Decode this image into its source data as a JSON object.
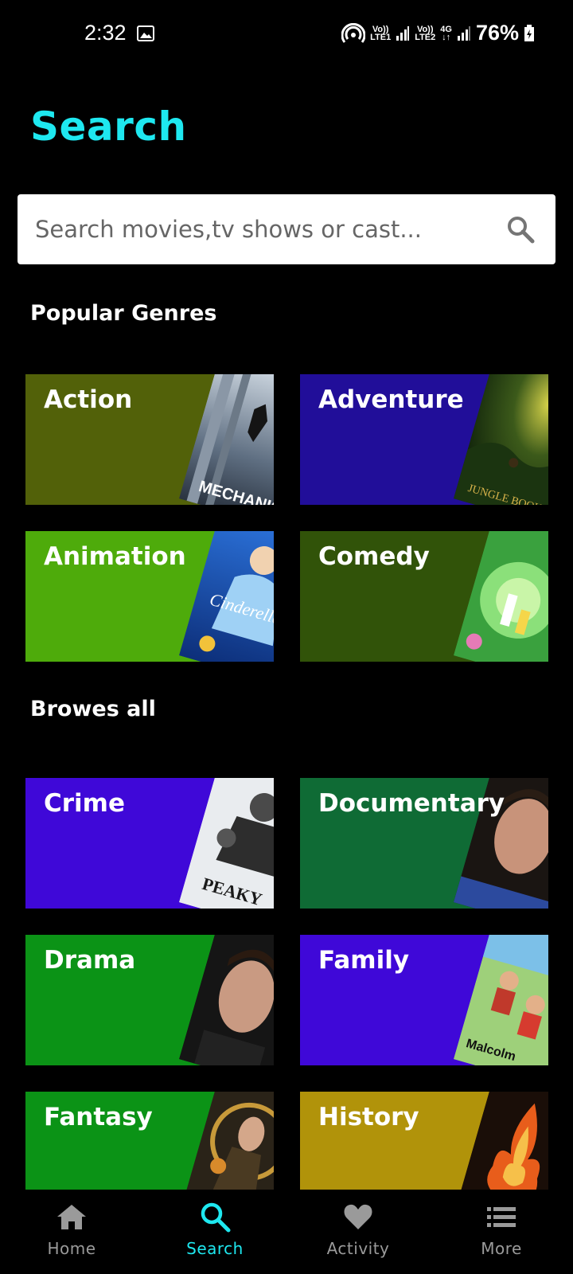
{
  "status": {
    "time": "2:32",
    "net1": [
      "Vo))",
      "LTE1"
    ],
    "net2": [
      "Vo))",
      "LTE2"
    ],
    "net3": [
      "4G",
      "↓↑"
    ],
    "battery": "76%"
  },
  "page": {
    "title": "Search"
  },
  "search": {
    "placeholder": "Search movies,tv shows or cast..."
  },
  "popular": {
    "title": "Popular Genres",
    "items": [
      {
        "label": "Action",
        "color": "#526109",
        "poster": "mechanic-poster"
      },
      {
        "label": "Adventure",
        "color": "#210e99",
        "poster": "jungle-book-poster"
      },
      {
        "label": "Animation",
        "color": "#4eab0b",
        "poster": "cinderella-poster"
      },
      {
        "label": "Comedy",
        "color": "#315309",
        "poster": "rick-and-morty-poster"
      }
    ]
  },
  "browse": {
    "title": "Browes all",
    "items": [
      {
        "label": "Crime",
        "color": "#3f08d8",
        "poster": "peaky-blinders-poster"
      },
      {
        "label": "Documentary",
        "color": "#0f6b35",
        "poster": "portrait-poster"
      },
      {
        "label": "Drama",
        "color": "#0b9316",
        "poster": "portrait-poster-2"
      },
      {
        "label": "Family",
        "color": "#3f08d8",
        "poster": "malcolm-poster"
      },
      {
        "label": "Fantasy",
        "color": "#0b9316",
        "poster": "loki-poster"
      },
      {
        "label": "History",
        "color": "#b1930a",
        "poster": "fire-poster"
      }
    ]
  },
  "nav": {
    "items": [
      {
        "label": "Home",
        "icon": "home-icon"
      },
      {
        "label": "Search",
        "icon": "search-icon"
      },
      {
        "label": "Activity",
        "icon": "heart-icon"
      },
      {
        "label": "More",
        "icon": "list-icon"
      }
    ],
    "active_color": "#1ee8f0",
    "inactive_color": "#9a9a9a"
  }
}
